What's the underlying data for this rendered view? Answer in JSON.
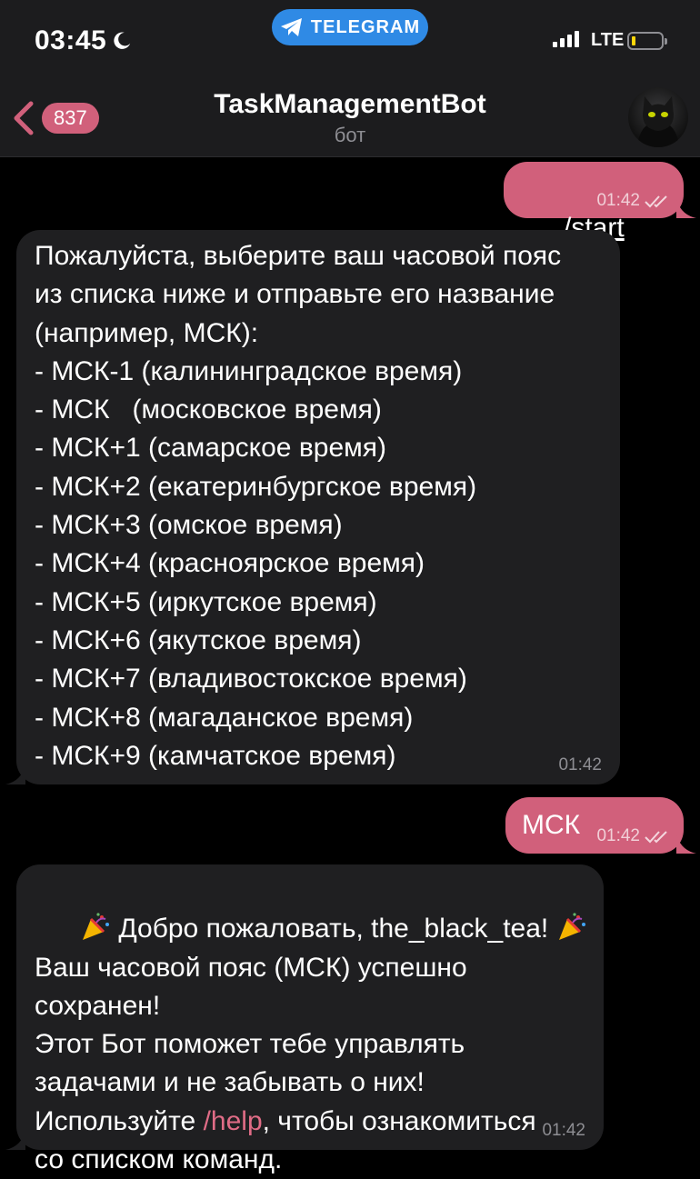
{
  "status_bar": {
    "time": "03:45",
    "app_pill": "TELEGRAM",
    "network": "LTE"
  },
  "header": {
    "back_count": "837",
    "title": "TaskManagementBot",
    "subtitle": "бот"
  },
  "messages": {
    "m1": {
      "text": "/start",
      "time": "01:42"
    },
    "m2": {
      "text": "Пожалуйста, выберите ваш часовой пояс\nиз списка ниже и отправьте его название\n(например, МСК):\n- МСК-1 (калининградское время)\n- МСК   (московское время)\n- МСК+1 (самарское время)\n- МСК+2 (екатеринбургское время)\n- МСК+3 (омское время)\n- МСК+4 (красноярское время)\n- МСК+5 (иркутское время)\n- МСК+6 (якутское время)\n- МСК+7 (владивостокское время)\n- МСК+8 (магаданское время)\n- МСК+9 (камчатское время)",
      "time": "01:42"
    },
    "m3": {
      "text": "МСК",
      "time": "01:42"
    },
    "m4": {
      "line1": " Добро пожаловать, the_black_tea! ",
      "body1": "Ваш часовой пояс (МСК) успешно\nсохранен!\nЭтот Бот поможет тебе управлять\nзадачами и не забывать о них!\nИспользуйте ",
      "link": "/help",
      "body2": ", чтобы ознакомиться\nсо списком команд.",
      "time": "01:42"
    }
  },
  "colors": {
    "outgoing_bubble": "#d1607b",
    "incoming_bubble": "#1f1f21",
    "telegram_pill": "#2f8ae5",
    "header_bg": "#1c1c1e"
  },
  "icons": [
    "moon-icon",
    "telegram-icon",
    "signal-icon",
    "battery-icon",
    "back-chevron-icon",
    "double-check-icon",
    "party-popper-icon"
  ]
}
